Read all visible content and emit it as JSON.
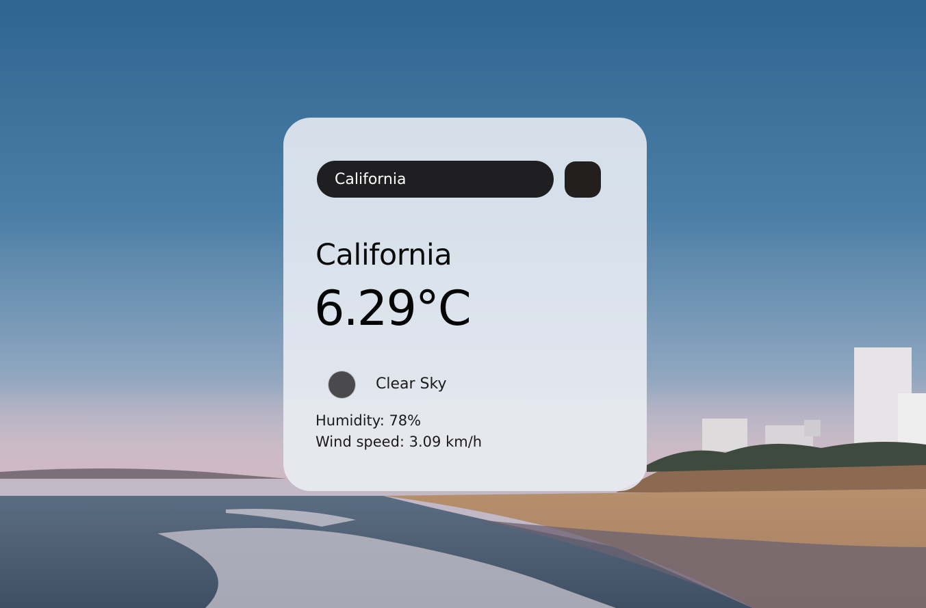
{
  "search": {
    "value": "California",
    "button_icon": "search-icon"
  },
  "weather": {
    "city": "California",
    "temperature": "6.29°C",
    "condition": "Clear Sky",
    "condition_icon": "weather-icon",
    "humidity": "Humidity: 78%",
    "wind": "Wind speed: 3.09 km/h"
  },
  "colors": {
    "card_bg": "#eaeef4",
    "input_bg": "#1f1f21",
    "button_bg": "#231f1f",
    "icon_fill": "#4a4a4c"
  }
}
